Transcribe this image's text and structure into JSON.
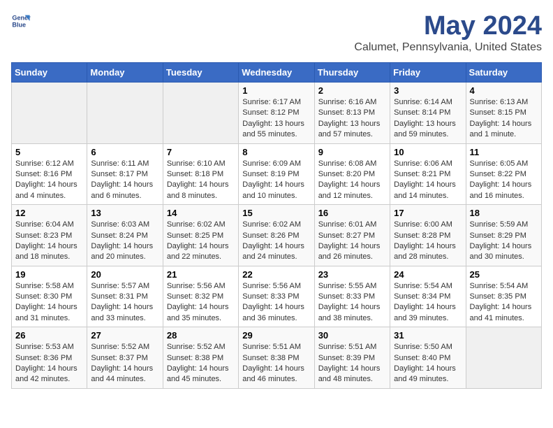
{
  "logo": {
    "line1": "General",
    "line2": "Blue"
  },
  "title": "May 2024",
  "subtitle": "Calumet, Pennsylvania, United States",
  "weekdays": [
    "Sunday",
    "Monday",
    "Tuesday",
    "Wednesday",
    "Thursday",
    "Friday",
    "Saturday"
  ],
  "weeks": [
    [
      {
        "day": "",
        "info": ""
      },
      {
        "day": "",
        "info": ""
      },
      {
        "day": "",
        "info": ""
      },
      {
        "day": "1",
        "info": "Sunrise: 6:17 AM\nSunset: 8:12 PM\nDaylight: 13 hours\nand 55 minutes."
      },
      {
        "day": "2",
        "info": "Sunrise: 6:16 AM\nSunset: 8:13 PM\nDaylight: 13 hours\nand 57 minutes."
      },
      {
        "day": "3",
        "info": "Sunrise: 6:14 AM\nSunset: 8:14 PM\nDaylight: 13 hours\nand 59 minutes."
      },
      {
        "day": "4",
        "info": "Sunrise: 6:13 AM\nSunset: 8:15 PM\nDaylight: 14 hours\nand 1 minute."
      }
    ],
    [
      {
        "day": "5",
        "info": "Sunrise: 6:12 AM\nSunset: 8:16 PM\nDaylight: 14 hours\nand 4 minutes."
      },
      {
        "day": "6",
        "info": "Sunrise: 6:11 AM\nSunset: 8:17 PM\nDaylight: 14 hours\nand 6 minutes."
      },
      {
        "day": "7",
        "info": "Sunrise: 6:10 AM\nSunset: 8:18 PM\nDaylight: 14 hours\nand 8 minutes."
      },
      {
        "day": "8",
        "info": "Sunrise: 6:09 AM\nSunset: 8:19 PM\nDaylight: 14 hours\nand 10 minutes."
      },
      {
        "day": "9",
        "info": "Sunrise: 6:08 AM\nSunset: 8:20 PM\nDaylight: 14 hours\nand 12 minutes."
      },
      {
        "day": "10",
        "info": "Sunrise: 6:06 AM\nSunset: 8:21 PM\nDaylight: 14 hours\nand 14 minutes."
      },
      {
        "day": "11",
        "info": "Sunrise: 6:05 AM\nSunset: 8:22 PM\nDaylight: 14 hours\nand 16 minutes."
      }
    ],
    [
      {
        "day": "12",
        "info": "Sunrise: 6:04 AM\nSunset: 8:23 PM\nDaylight: 14 hours\nand 18 minutes."
      },
      {
        "day": "13",
        "info": "Sunrise: 6:03 AM\nSunset: 8:24 PM\nDaylight: 14 hours\nand 20 minutes."
      },
      {
        "day": "14",
        "info": "Sunrise: 6:02 AM\nSunset: 8:25 PM\nDaylight: 14 hours\nand 22 minutes."
      },
      {
        "day": "15",
        "info": "Sunrise: 6:02 AM\nSunset: 8:26 PM\nDaylight: 14 hours\nand 24 minutes."
      },
      {
        "day": "16",
        "info": "Sunrise: 6:01 AM\nSunset: 8:27 PM\nDaylight: 14 hours\nand 26 minutes."
      },
      {
        "day": "17",
        "info": "Sunrise: 6:00 AM\nSunset: 8:28 PM\nDaylight: 14 hours\nand 28 minutes."
      },
      {
        "day": "18",
        "info": "Sunrise: 5:59 AM\nSunset: 8:29 PM\nDaylight: 14 hours\nand 30 minutes."
      }
    ],
    [
      {
        "day": "19",
        "info": "Sunrise: 5:58 AM\nSunset: 8:30 PM\nDaylight: 14 hours\nand 31 minutes."
      },
      {
        "day": "20",
        "info": "Sunrise: 5:57 AM\nSunset: 8:31 PM\nDaylight: 14 hours\nand 33 minutes."
      },
      {
        "day": "21",
        "info": "Sunrise: 5:56 AM\nSunset: 8:32 PM\nDaylight: 14 hours\nand 35 minutes."
      },
      {
        "day": "22",
        "info": "Sunrise: 5:56 AM\nSunset: 8:33 PM\nDaylight: 14 hours\nand 36 minutes."
      },
      {
        "day": "23",
        "info": "Sunrise: 5:55 AM\nSunset: 8:33 PM\nDaylight: 14 hours\nand 38 minutes."
      },
      {
        "day": "24",
        "info": "Sunrise: 5:54 AM\nSunset: 8:34 PM\nDaylight: 14 hours\nand 39 minutes."
      },
      {
        "day": "25",
        "info": "Sunrise: 5:54 AM\nSunset: 8:35 PM\nDaylight: 14 hours\nand 41 minutes."
      }
    ],
    [
      {
        "day": "26",
        "info": "Sunrise: 5:53 AM\nSunset: 8:36 PM\nDaylight: 14 hours\nand 42 minutes."
      },
      {
        "day": "27",
        "info": "Sunrise: 5:52 AM\nSunset: 8:37 PM\nDaylight: 14 hours\nand 44 minutes."
      },
      {
        "day": "28",
        "info": "Sunrise: 5:52 AM\nSunset: 8:38 PM\nDaylight: 14 hours\nand 45 minutes."
      },
      {
        "day": "29",
        "info": "Sunrise: 5:51 AM\nSunset: 8:38 PM\nDaylight: 14 hours\nand 46 minutes."
      },
      {
        "day": "30",
        "info": "Sunrise: 5:51 AM\nSunset: 8:39 PM\nDaylight: 14 hours\nand 48 minutes."
      },
      {
        "day": "31",
        "info": "Sunrise: 5:50 AM\nSunset: 8:40 PM\nDaylight: 14 hours\nand 49 minutes."
      },
      {
        "day": "",
        "info": ""
      }
    ]
  ]
}
